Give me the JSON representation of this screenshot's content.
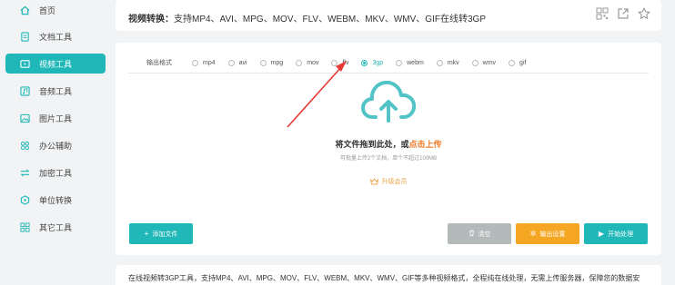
{
  "sidebar": {
    "items": [
      {
        "label": "首页",
        "icon": "home-icon",
        "active": false
      },
      {
        "label": "文档工具",
        "icon": "document-icon",
        "active": false
      },
      {
        "label": "视频工具",
        "icon": "video-icon",
        "active": true
      },
      {
        "label": "音频工具",
        "icon": "audio-icon",
        "active": false
      },
      {
        "label": "图片工具",
        "icon": "image-icon",
        "active": false
      },
      {
        "label": "办公辅助",
        "icon": "office-icon",
        "active": false
      },
      {
        "label": "加密工具",
        "icon": "encrypt-icon",
        "active": false
      },
      {
        "label": "单位转换",
        "icon": "unit-icon",
        "active": false
      },
      {
        "label": "其它工具",
        "icon": "other-icon",
        "active": false
      }
    ]
  },
  "header": {
    "title_prefix": "视频转换：",
    "title_rest": "支持MP4、AVI、MPG、MOV、FLV、WEBM、MKV、WMV、GIF在线转3GP",
    "icons": [
      "qrcode-icon",
      "share-icon",
      "star-icon"
    ]
  },
  "format": {
    "label": "输出格式",
    "options": [
      "mp4",
      "avi",
      "mpg",
      "mov",
      "flv",
      "3gp",
      "webm",
      "mkv",
      "wmv",
      "gif"
    ],
    "selected": "3gp"
  },
  "upload": {
    "drop_text": "将文件拖到此处，或",
    "drop_link": "点击上传",
    "hint": "可批量上传2个文档，单个不超过100MB",
    "upgrade": "升级会员"
  },
  "buttons": {
    "add": "添加文件",
    "clear": "清空",
    "settings": "输出设置",
    "start": "开始处理"
  },
  "description": "在线视频转3GP工具，支持MP4、AVI、MPG、MOV、FLV、WEBM、MKV、WMV、GIF等多种视频格式，全程纯在线处理，无需上传服务器，保障您的数据安",
  "colors": {
    "accent": "#1fb7b7",
    "orange": "#f5a623",
    "link": "#f07c2a",
    "arrow": "#e53935",
    "disabled": "#b4b9b9"
  }
}
